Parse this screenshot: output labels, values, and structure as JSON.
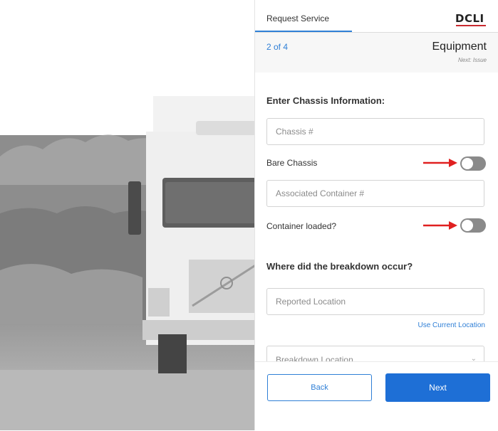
{
  "header": {
    "tab_label": "Request Service",
    "logo_text": "DCLI"
  },
  "step": {
    "count": "2 of 4",
    "title": "Equipment",
    "next": "Next: Issue"
  },
  "chassis_section": {
    "title": "Enter Chassis Information:",
    "chassis_placeholder": "Chassis #",
    "chassis_value": "",
    "bare_chassis_label": "Bare Chassis",
    "bare_chassis_on": false,
    "container_placeholder": "Associated Container #",
    "container_value": "",
    "container_loaded_label": "Container loaded?",
    "container_loaded_on": false
  },
  "breakdown_section": {
    "title": "Where did the breakdown occur?",
    "reported_location_placeholder": "Reported Location",
    "reported_location_value": "",
    "use_current_location": "Use Current Location",
    "breakdown_location_label": "Breakdown Location"
  },
  "footer": {
    "back_label": "Back",
    "next_label": "Next"
  },
  "colors": {
    "accent": "#1e6fd6",
    "link": "#2f7fd6",
    "toggle_off": "#8a8a8a",
    "arrow": "#e02020",
    "logo_red": "#c8292f"
  },
  "icons": {
    "arrow": "red-arrow-icon",
    "chevron": "chevron-down-icon"
  }
}
